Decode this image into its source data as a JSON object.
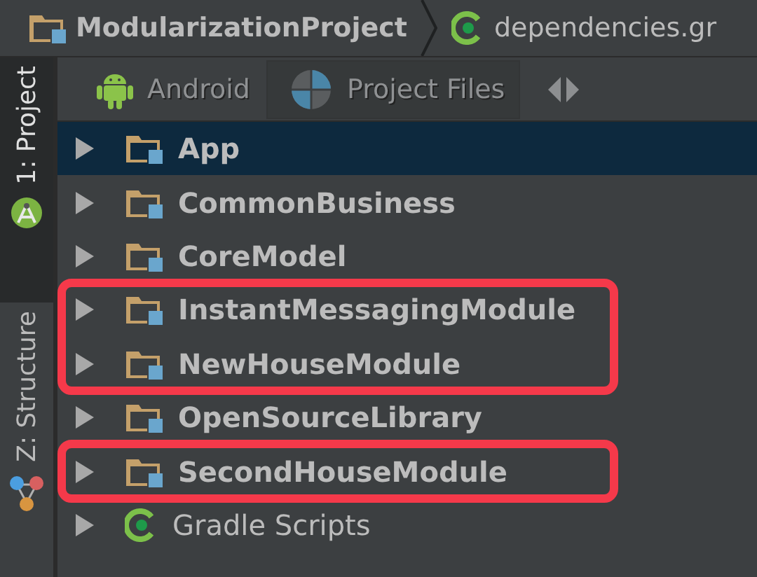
{
  "breadcrumb": [
    {
      "kind": "folder",
      "label": "ModularizationProject"
    },
    {
      "kind": "gradle",
      "label": "dependencies.gr"
    }
  ],
  "tool_strip": [
    {
      "label": "1: Project",
      "kind": "android",
      "selected": true
    },
    {
      "label": "Z: Structure",
      "kind": "structure",
      "selected": false
    }
  ],
  "view_tabs": [
    {
      "label": "Android",
      "kind": "android",
      "selected": false
    },
    {
      "label": "Project Files",
      "kind": "pie",
      "selected": true
    }
  ],
  "tree": [
    {
      "label": "App",
      "kind": "module",
      "selected": true,
      "expanded": false,
      "highlighted": false
    },
    {
      "label": "CommonBusiness",
      "kind": "module",
      "selected": false,
      "expanded": false,
      "highlighted": false
    },
    {
      "label": "CoreModel",
      "kind": "module",
      "selected": false,
      "expanded": false,
      "highlighted": false
    },
    {
      "label": "InstantMessagingModule",
      "kind": "module",
      "selected": false,
      "expanded": false,
      "highlighted": true
    },
    {
      "label": "NewHouseModule",
      "kind": "module",
      "selected": false,
      "expanded": false,
      "highlighted": true
    },
    {
      "label": "OpenSourceLibrary",
      "kind": "module",
      "selected": false,
      "expanded": false,
      "highlighted": false
    },
    {
      "label": "SecondHouseModule",
      "kind": "module",
      "selected": false,
      "expanded": false,
      "highlighted": true
    },
    {
      "label": "Gradle Scripts",
      "kind": "gradle",
      "selected": false,
      "expanded": false,
      "highlighted": false
    }
  ]
}
